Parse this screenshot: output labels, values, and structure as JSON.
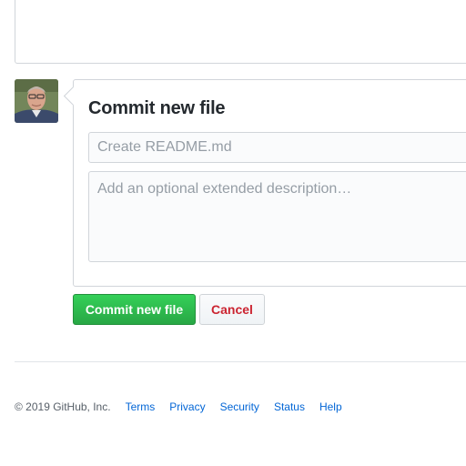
{
  "commit": {
    "title": "Commit new file",
    "summary_placeholder": "Create README.md",
    "summary_value": "",
    "description_placeholder": "Add an optional extended description…",
    "description_value": "",
    "commit_button_label": "Commit new file",
    "cancel_button_label": "Cancel"
  },
  "footer": {
    "copyright": "© 2019 GitHub, Inc.",
    "links": [
      "Terms",
      "Privacy",
      "Security",
      "Status",
      "Help"
    ]
  },
  "colors": {
    "primary_button": "#2ea44f",
    "danger_text": "#cb2431",
    "link": "#0366d6",
    "border": "#d1d5da"
  },
  "icons": {
    "avatar": "user-avatar-photo"
  }
}
